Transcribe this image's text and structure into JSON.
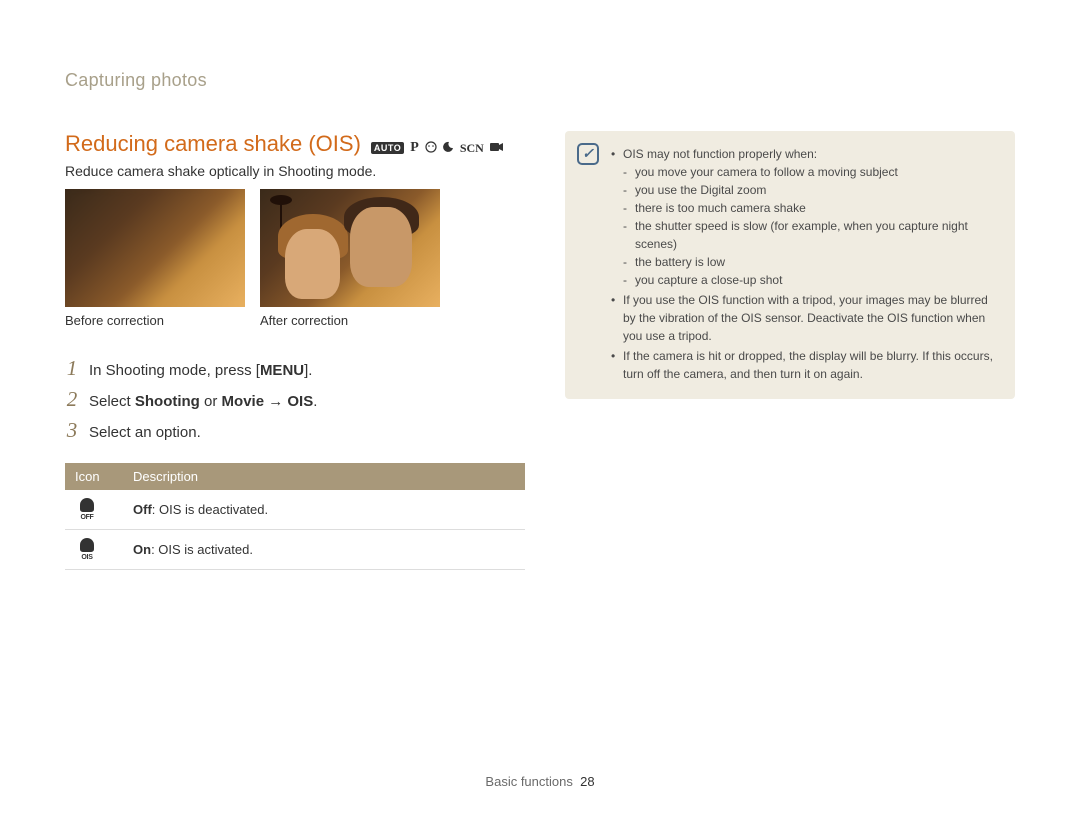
{
  "breadcrumb": "Capturing photos",
  "section": {
    "title": "Reducing camera shake (OIS)",
    "modes": [
      "AUTO",
      "P",
      "moon-face",
      "moon",
      "SCN",
      "movie"
    ],
    "intro": "Reduce camera shake optically in Shooting mode."
  },
  "photos": {
    "before_caption": "Before correction",
    "after_caption": "After correction"
  },
  "steps": [
    {
      "num": "1",
      "text": "In Shooting mode, press [",
      "bold": "MENU",
      "tail": "]."
    },
    {
      "num": "2",
      "prefix": "Select ",
      "b1": "Shooting",
      "mid": " or ",
      "b2": "Movie",
      "arrow": " → ",
      "b3": "OIS",
      "end": "."
    },
    {
      "num": "3",
      "plain": "Select an option."
    }
  ],
  "table": {
    "head_icon": "Icon",
    "head_desc": "Description",
    "rows": [
      {
        "icon": "off",
        "label": "Off",
        "desc": ": OIS is deactivated."
      },
      {
        "icon": "on",
        "label": "On",
        "desc": ": OIS is activated."
      }
    ]
  },
  "notes": {
    "lead": "OIS may not function properly when:",
    "sub": [
      "you move your camera to follow a moving subject",
      "you use the Digital zoom",
      "there is too much camera shake",
      "the shutter speed is slow (for example, when you capture night scenes)",
      "the battery is low",
      "you capture a close-up shot"
    ],
    "b2": "If you use the OIS function with a tripod, your images may be blurred by the vibration of the OIS sensor. Deactivate the OIS function when you use a tripod.",
    "b3": "If the camera is hit or dropped, the display will be blurry. If this occurs, turn off the camera, and then turn it on again."
  },
  "footer": {
    "section": "Basic functions",
    "page": "28"
  }
}
